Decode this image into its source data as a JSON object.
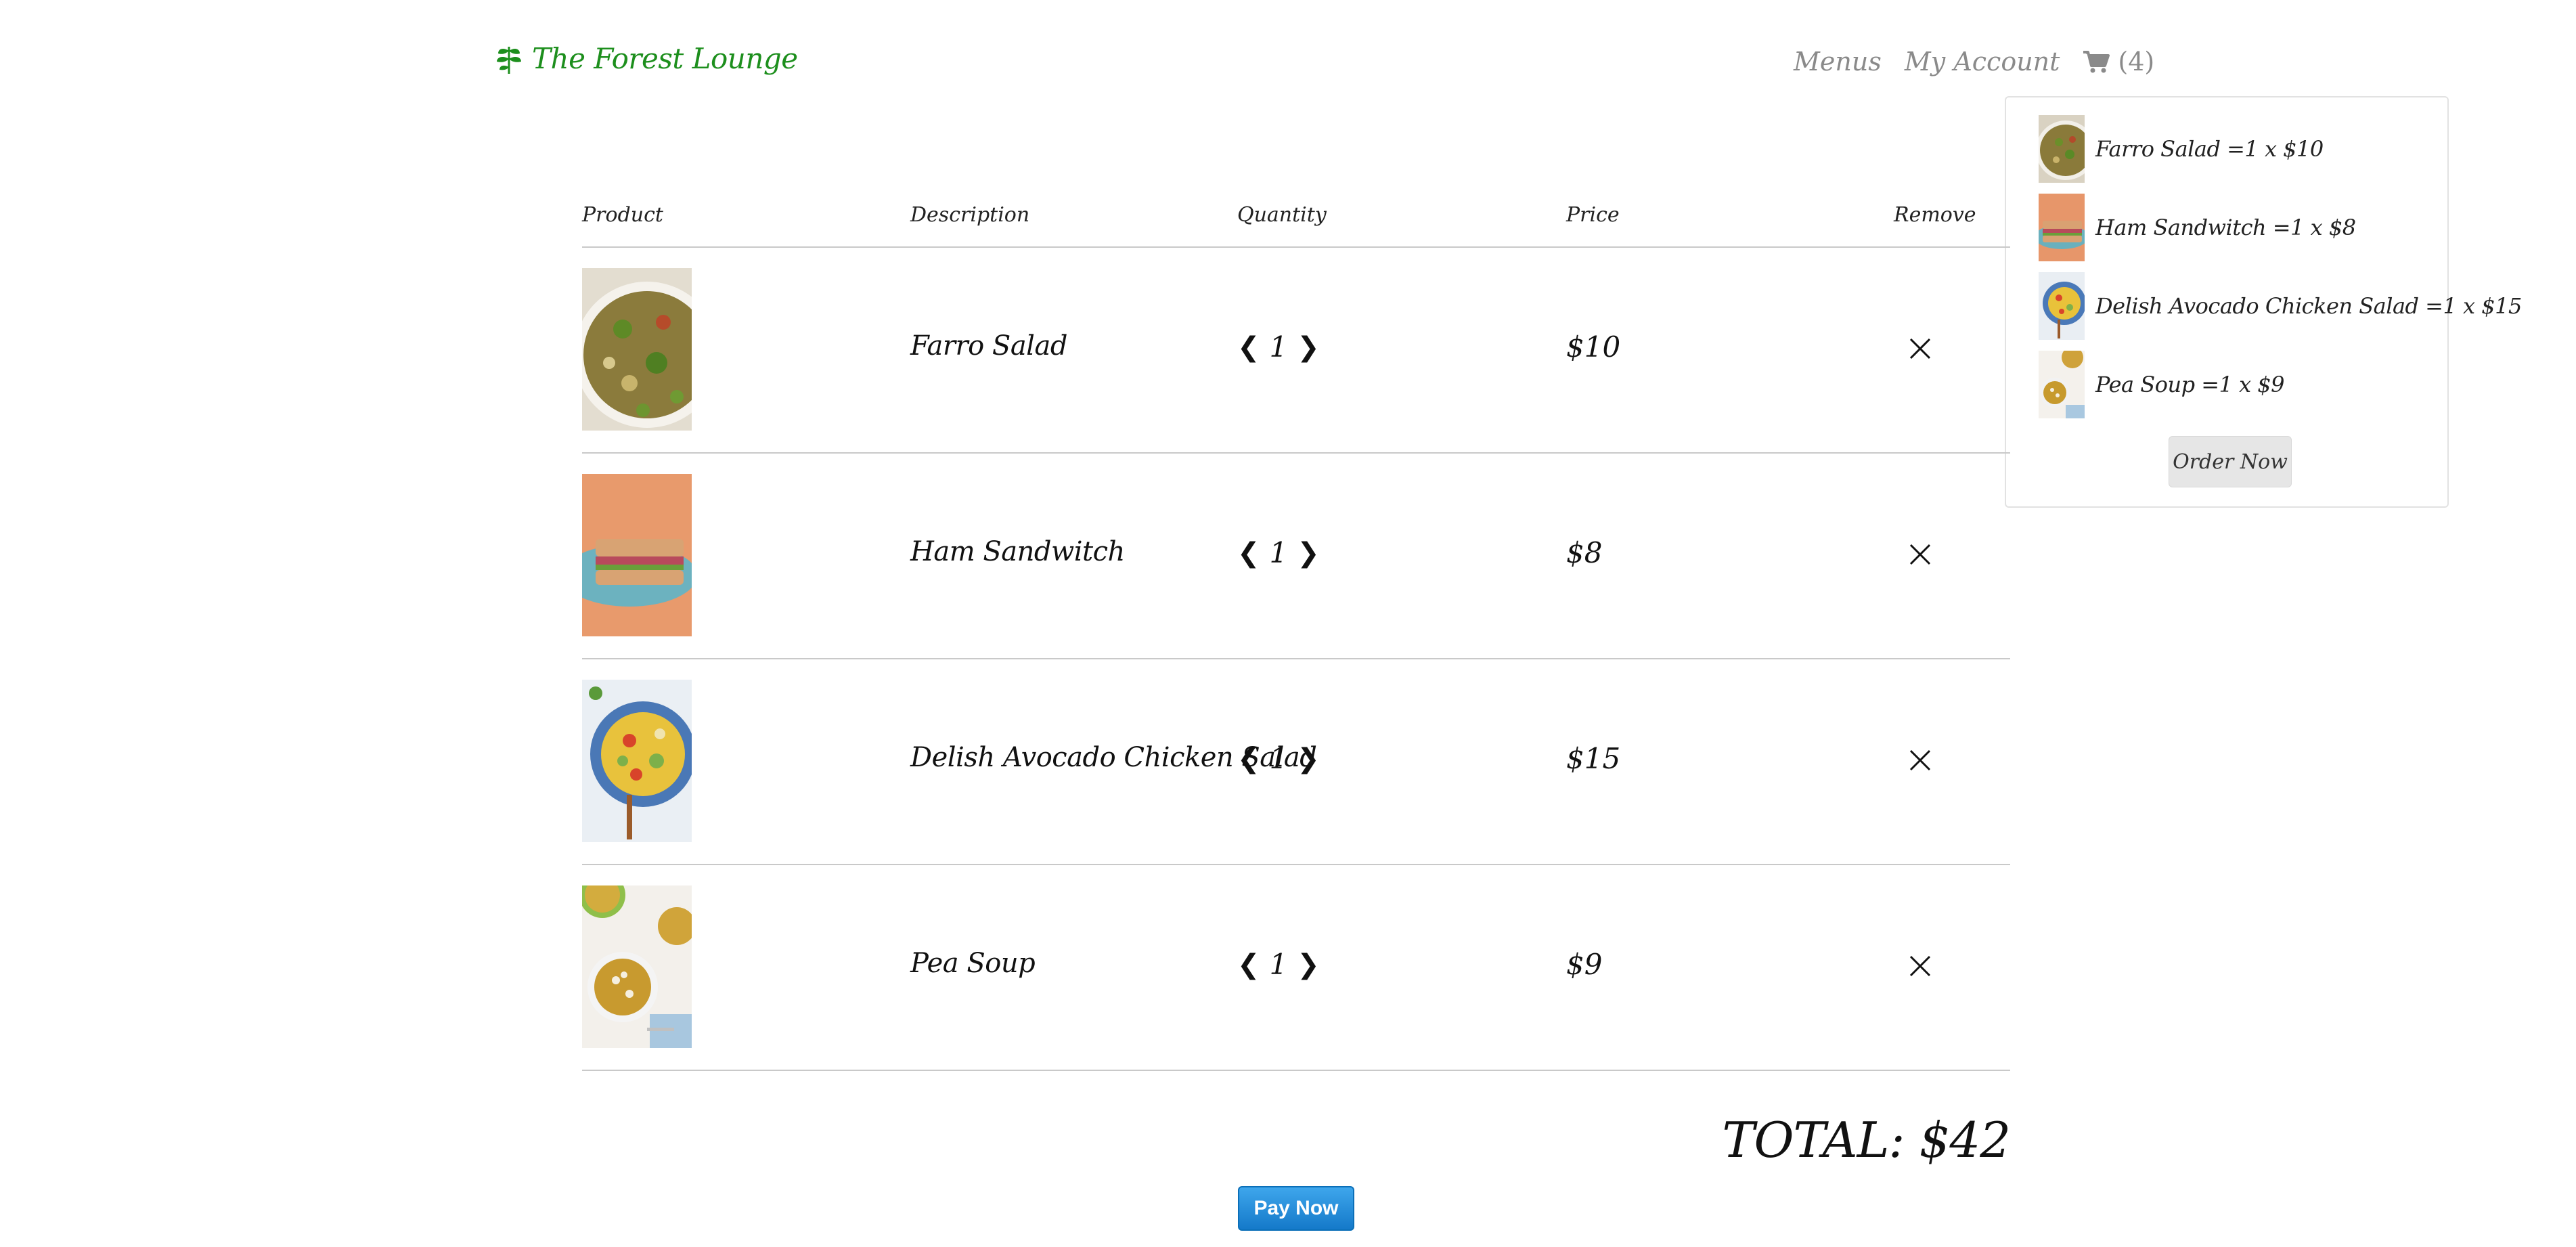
{
  "brand": {
    "name": "The Forest Lounge",
    "logo_icon": "leaf-icon",
    "color": "#1d8f1d"
  },
  "nav": {
    "items": [
      {
        "label": "Menus"
      },
      {
        "label": "My Account"
      }
    ],
    "cart": {
      "icon": "shopping-cart-icon",
      "count_label": "(4)"
    }
  },
  "cart_dropdown": {
    "items": [
      {
        "label": "Farro Salad =1 x $10"
      },
      {
        "label": "Ham Sandwitch =1 x $8"
      },
      {
        "label": "Delish Avocado Chicken Salad =1 x $15"
      },
      {
        "label": "Pea Soup =1 x $9"
      }
    ],
    "order_button": "Order Now"
  },
  "table": {
    "headers": [
      "Product",
      "Description",
      "Quantity",
      "Price",
      "Remove"
    ],
    "rows": [
      {
        "description": "Farro Salad",
        "quantity": "1",
        "price": "$10"
      },
      {
        "description": "Ham Sandwitch",
        "quantity": "1",
        "price": "$8"
      },
      {
        "description": "Delish Avocado Chicken Salad",
        "quantity": "1",
        "price": "$15"
      },
      {
        "description": "Pea Soup",
        "quantity": "1",
        "price": "$9"
      }
    ],
    "decrease_glyph": "❮",
    "increase_glyph": "❯"
  },
  "total": "TOTAL: $42",
  "pay_button": "Pay Now",
  "colors": {
    "accent_green": "#1d8f1d",
    "pay_blue": "#1479c9",
    "nav_gray": "#8a8a8a"
  }
}
